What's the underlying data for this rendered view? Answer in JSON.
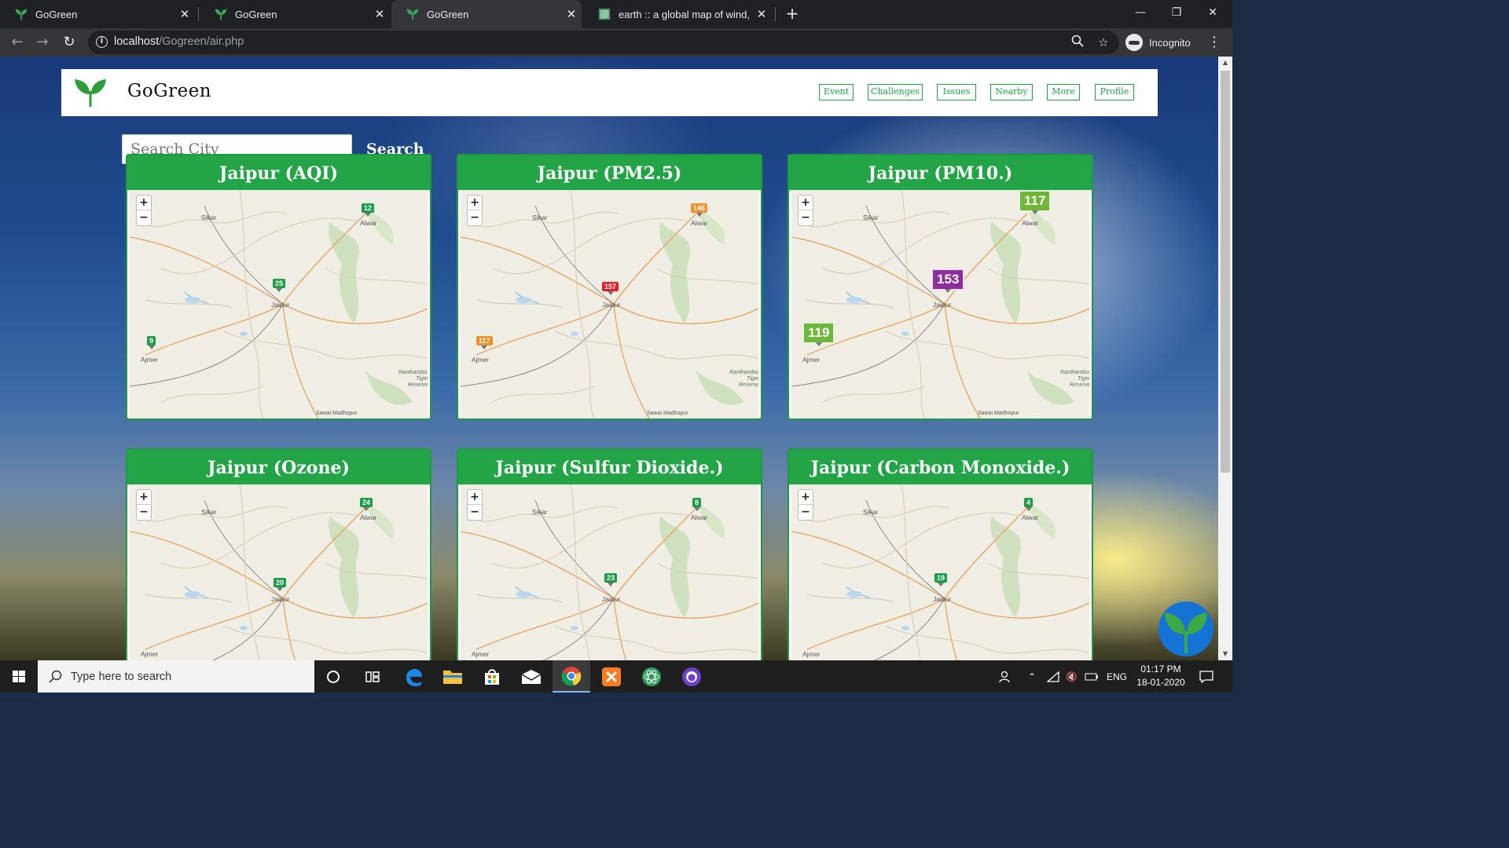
{
  "browser": {
    "tabs": [
      {
        "label": "GoGreen",
        "active": false
      },
      {
        "label": "GoGreen",
        "active": false
      },
      {
        "label": "GoGreen",
        "active": true
      },
      {
        "label": "earth :: a global map of wind, we",
        "active": false
      }
    ],
    "url_host": "localhost",
    "url_path": "/Gogreen/air.php",
    "incognito_label": "Incognito"
  },
  "site": {
    "brand": "GoGreen",
    "nav": [
      "Event",
      "Challenges",
      "Issues",
      "Nearby",
      "More",
      "Profile"
    ],
    "search_placeholder": "Search City",
    "search_button": "Search",
    "accent_color": "#22a447"
  },
  "map_labels": {
    "sikar": "Sikar",
    "alwar": "Alwar",
    "jaipur": "Jaipur",
    "ajmer": "Ajmer",
    "ranthambore": "Ranthambore Tiger Reserve",
    "sawai": "Sawai Madhopur",
    "zoom_in": "+",
    "zoom_out": "−"
  },
  "cards": [
    {
      "title": "Jaipur (AQI)",
      "markers": {
        "alwar": "12",
        "jaipur": "25",
        "ajmer": "9"
      }
    },
    {
      "title": "Jaipur (PM2.5)",
      "markers": {
        "alwar": "146",
        "jaipur": "157",
        "ajmer": "117"
      }
    },
    {
      "title": "Jaipur (PM10.)",
      "markers": {
        "alwar": "117",
        "jaipur": "153",
        "ajmer": "119"
      }
    },
    {
      "title": "Jaipur (Ozone)",
      "markers": {
        "alwar": "24",
        "jaipur": "20"
      }
    },
    {
      "title": "Jaipur (Sulfur Dioxide.)",
      "markers": {
        "alwar": "8",
        "jaipur": "23"
      }
    },
    {
      "title": "Jaipur (Carbon Monoxide.)",
      "markers": {
        "alwar": "4",
        "jaipur": "19"
      }
    }
  ],
  "taskbar": {
    "search_placeholder": "Type here to search",
    "language": "ENG",
    "time": "01:17 PM",
    "date": "18-01-2020"
  }
}
